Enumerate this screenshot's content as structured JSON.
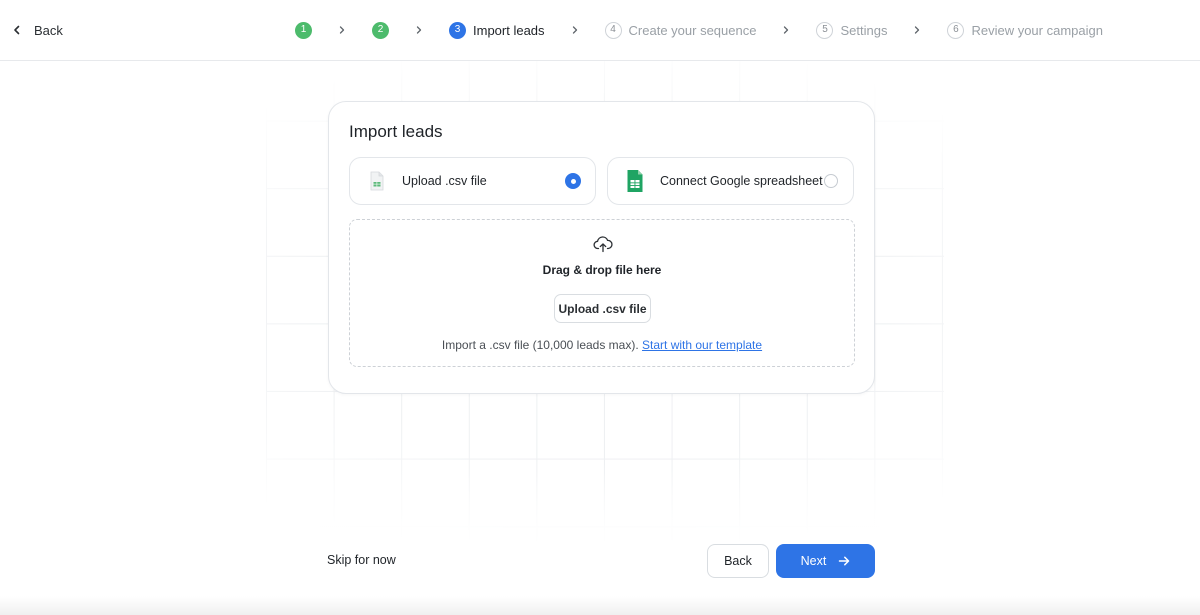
{
  "header": {
    "back_label": "Back",
    "steps": [
      {
        "num": "1",
        "label": "",
        "state": "done"
      },
      {
        "num": "2",
        "label": "",
        "state": "done"
      },
      {
        "num": "3",
        "label": "Import leads",
        "state": "active"
      },
      {
        "num": "4",
        "label": "Create your sequence",
        "state": "pending"
      },
      {
        "num": "5",
        "label": "Settings",
        "state": "pending"
      },
      {
        "num": "6",
        "label": "Review your campaign",
        "state": "pending"
      }
    ]
  },
  "card": {
    "title": "Import leads",
    "options": {
      "csv": {
        "label": "Upload .csv file",
        "selected": true
      },
      "gsheet": {
        "label": "Connect Google spreadsheet",
        "selected": false
      }
    },
    "dropzone": {
      "title": "Drag & drop file here",
      "button_label": "Upload .csv file",
      "note": "Import a .csv file (10,000 leads max).",
      "link_label": "Start with our template"
    }
  },
  "footer": {
    "skip_label": "Skip for now",
    "back_label": "Back",
    "next_label": "Next"
  },
  "colors": {
    "accent": "#2e74e6",
    "done": "#4dbb6c",
    "sheets_green": "#1fa463"
  }
}
